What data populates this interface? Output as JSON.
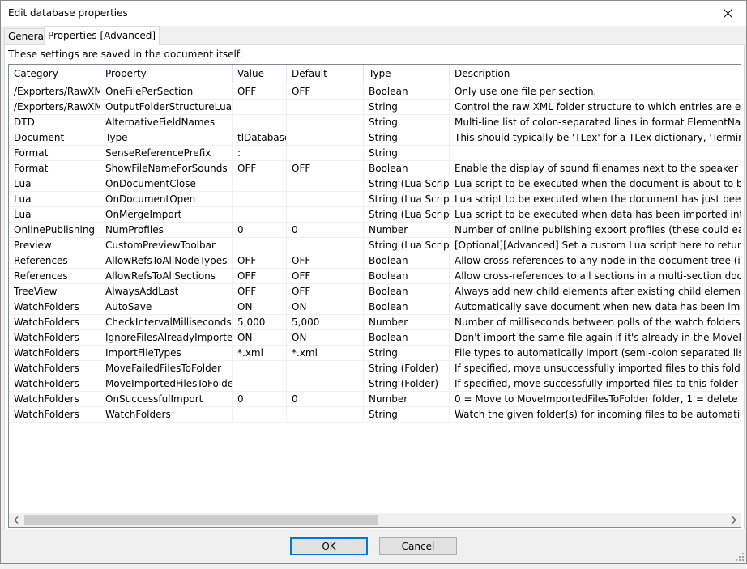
{
  "window": {
    "title": "Edit database properties"
  },
  "tabs": [
    {
      "label": "General"
    },
    {
      "label": "Properties [Advanced]"
    }
  ],
  "panel": {
    "note": "These settings are saved in the document itself:"
  },
  "table": {
    "columns": [
      "Category",
      "Property",
      "Value",
      "Default",
      "Type",
      "Description"
    ],
    "rows": [
      [
        "/Exporters/RawXML",
        "OneFilePerSection",
        "OFF",
        "OFF",
        "Boolean",
        "Only use one file per section."
      ],
      [
        "/Exporters/RawXML",
        "OutputFolderStructureLua",
        "",
        "",
        "String",
        "Control the raw XML folder structure to which entries are exported."
      ],
      [
        "DTD",
        "AlternativeFieldNames",
        "",
        "",
        "String",
        "Multi-line list of colon-separated lines in format ElementName:Alter"
      ],
      [
        "Document",
        "Type",
        "tlDatabase",
        "",
        "String",
        "This should typically be 'TLex' for a TLex dictionary, 'Terminology' fo"
      ],
      [
        "Format",
        "SenseReferencePrefix",
        ":",
        "",
        "String",
        ""
      ],
      [
        "Format",
        "ShowFileNameForSounds",
        "OFF",
        "OFF",
        "Boolean",
        "Enable the display of sound filenames next to the speaker icon for so"
      ],
      [
        "Lua",
        "OnDocumentClose",
        "",
        "",
        "String (Lua Script)",
        "Lua script to be executed when the document is about to be closed"
      ],
      [
        "Lua",
        "OnDocumentOpen",
        "",
        "",
        "String (Lua Script)",
        "Lua script to be executed when the document has just been opened"
      ],
      [
        "Lua",
        "OnMergeImport",
        "",
        "",
        "String (Lua Script)",
        "Lua script to be executed when data has been imported into an exist"
      ],
      [
        "OnlinePublishing",
        "NumProfiles",
        "0",
        "0",
        "Number",
        "Number of online publishing export profiles (these could each corre"
      ],
      [
        "Preview",
        "CustomPreviewToolbar",
        "",
        "",
        "String (Lua Script)",
        "[Optional][Advanced] Set a custom Lua script here to return an HTM"
      ],
      [
        "References",
        "AllowRefsToAllNodeTypes",
        "OFF",
        "OFF",
        "Boolean",
        "Allow cross-references to any node in the document tree (in TLex by"
      ],
      [
        "References",
        "AllowRefsToAllSections",
        "OFF",
        "OFF",
        "Boolean",
        "Allow cross-references to all sections in a multi-section document (i"
      ],
      [
        "TreeView",
        "AlwaysAddLast",
        "OFF",
        "OFF",
        "Boolean",
        "Always add new child elements after existing child elements"
      ],
      [
        "WatchFolders",
        "AutoSave",
        "ON",
        "ON",
        "Boolean",
        "Automatically save document when new data has been imported"
      ],
      [
        "WatchFolders",
        "CheckIntervalMilliseconds",
        "5,000",
        "5,000",
        "Number",
        "Number of milliseconds between polls of the watch folders"
      ],
      [
        "WatchFolders",
        "IgnoreFilesAlreadyImported",
        "ON",
        "ON",
        "Boolean",
        "Don't import the same file again if it's already in the MoveImportedF"
      ],
      [
        "WatchFolders",
        "ImportFileTypes",
        "*.xml",
        "*.xml",
        "String",
        "File types to automatically import (semi-colon separated list)"
      ],
      [
        "WatchFolders",
        "MoveFailedFilesToFolder",
        "",
        "",
        "String (Folder)",
        "If specified, move unsuccessfully imported files to this folder"
      ],
      [
        "WatchFolders",
        "MoveImportedFilesToFolder",
        "",
        "",
        "String (Folder)",
        "If specified, move successfully imported files to this folder"
      ],
      [
        "WatchFolders",
        "OnSuccessfulImport",
        "0",
        "0",
        "Number",
        "0 = Move to MoveImportedFilesToFolder folder, 1 = delete file"
      ],
      [
        "WatchFolders",
        "WatchFolders",
        "",
        "",
        "String",
        "Watch the given folder(s) for incoming files to be automatically imp"
      ]
    ]
  },
  "buttons": {
    "ok": "OK",
    "cancel": "Cancel"
  },
  "icons": {
    "close": "close-icon",
    "scroll_left": "chevron-left-icon",
    "scroll_right": "chevron-right-icon",
    "grip": "resize-grip-icon"
  },
  "colors": {
    "accent": "#0078d7",
    "scroll_thumb": "#cdcdcd"
  }
}
